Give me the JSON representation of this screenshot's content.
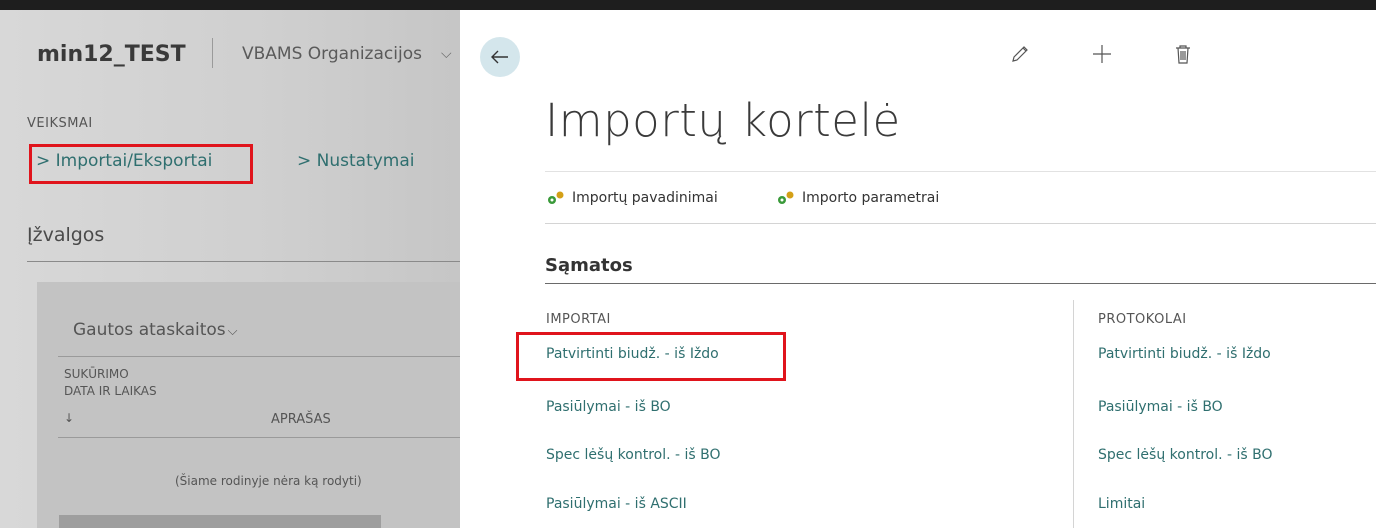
{
  "left_panel": {
    "company": "min12_TEST",
    "organization": "VBAMS Organizacijos",
    "actions_header": "VEIKSMAI",
    "actions": [
      {
        "label": "> Importai/Eksportai"
      },
      {
        "label": "> Nustatymai"
      }
    ],
    "insights_title": "Įžvalgos",
    "card": {
      "title": "Gautos ataskaitos",
      "col_created": "SUKŪRIMO\nDATA IR LAIKAS",
      "sort_arrow": "↓",
      "col_description": "APRAŠAS",
      "empty_text": "(Šiame rodinyje nėra ką rodyti)"
    }
  },
  "page": {
    "title": "Importų kortelė",
    "actions": [
      {
        "label": "Importų pavadinimai"
      },
      {
        "label": "Importo parametrai"
      }
    ],
    "section": "Sąmatos",
    "groups": [
      {
        "title": "IMPORTAI",
        "links": [
          "Patvirtinti biudž. - iš Iždo",
          "Pasiūlymai - iš BO",
          "Spec lėšų kontrol. - iš BO",
          "Pasiūlymai - iš ASCII"
        ]
      },
      {
        "title": "PROTOKOLAI",
        "links": [
          "Patvirtinti biudž. - iš Iždo",
          "Pasiūlymai - iš BO",
          "Spec lėšų kontrol. - iš BO",
          "Limitai"
        ]
      }
    ]
  },
  "colors": {
    "link": "#2f6f6f",
    "highlight": "#e0141c",
    "back_button": "#d4e6ec"
  },
  "icons": [
    "back-arrow-icon",
    "edit-icon",
    "plus-icon",
    "delete-icon",
    "action-icon",
    "chevron-down-icon"
  ]
}
